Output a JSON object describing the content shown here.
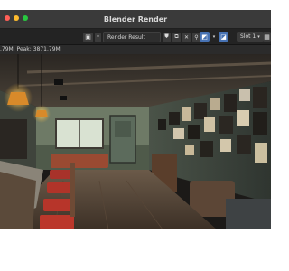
{
  "window": {
    "title": "Blender Render"
  },
  "toolbar": {
    "image_selector": "Render Result",
    "slot": "Slot 1"
  },
  "info_bar": {
    "text": ".79M, Peak: 3871.79M"
  },
  "colors": {
    "accent": "#4772b3",
    "window_bg": "#2b2b2b",
    "toolbar_bg": "#232323",
    "lamp_glow": "#f0b53f"
  },
  "icons": [
    "image-icon",
    "browse-image-icon",
    "fake-user-icon",
    "new-image-icon",
    "unlink-icon",
    "pin-icon",
    "view-icon",
    "display-channels-icon",
    "chevron-down-icon",
    "checkerboard-icon"
  ]
}
